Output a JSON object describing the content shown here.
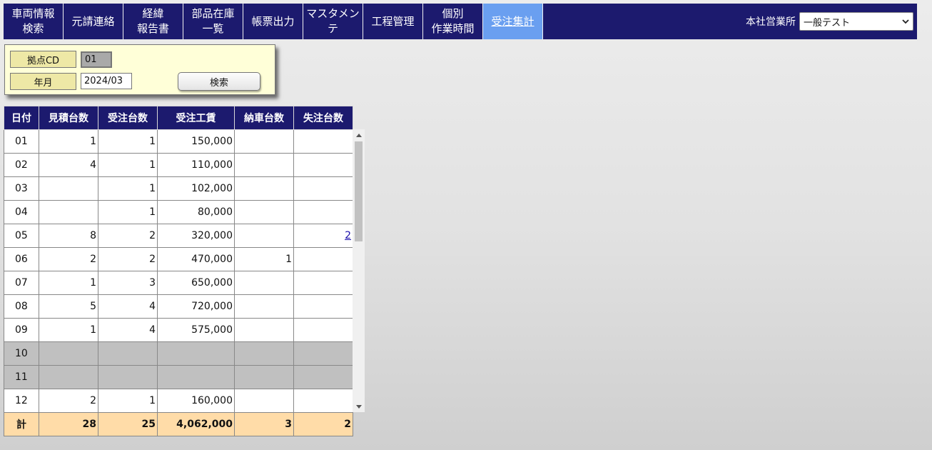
{
  "nav": {
    "items": [
      {
        "line1": "車両情報",
        "line2": "検索"
      },
      {
        "line1": "元請連絡",
        "line2": ""
      },
      {
        "line1": "経緯",
        "line2": "報告書"
      },
      {
        "line1": "部品在庫",
        "line2": "一覧"
      },
      {
        "line1": "帳票出力",
        "line2": ""
      },
      {
        "line1": "マスタメンテ",
        "line2": ""
      },
      {
        "line1": "工程管理",
        "line2": ""
      },
      {
        "line1": "個別",
        "line2": "作業時間"
      },
      {
        "line1": "受注集計",
        "line2": ""
      }
    ],
    "active_index": 8,
    "office_label": "本社営業所",
    "office_selected": "一般テスト"
  },
  "search": {
    "cd_label": "拠点CD",
    "cd_value": "01",
    "ym_label": "年月",
    "ym_value": "2024/03",
    "button_label": "検索"
  },
  "table": {
    "headers": [
      "日付",
      "見積台数",
      "受注台数",
      "受注工賃",
      "納車台数",
      "失注台数"
    ],
    "rows": [
      {
        "day": "01",
        "estimates": "1",
        "orders": "1",
        "labor": "150,000",
        "deliveries": "",
        "lost": "",
        "holiday": false
      },
      {
        "day": "02",
        "estimates": "4",
        "orders": "1",
        "labor": "110,000",
        "deliveries": "",
        "lost": "",
        "holiday": false
      },
      {
        "day": "03",
        "estimates": "",
        "orders": "1",
        "labor": "102,000",
        "deliveries": "",
        "lost": "",
        "holiday": false
      },
      {
        "day": "04",
        "estimates": "",
        "orders": "1",
        "labor": "80,000",
        "deliveries": "",
        "lost": "",
        "holiday": false
      },
      {
        "day": "05",
        "estimates": "8",
        "orders": "2",
        "labor": "320,000",
        "deliveries": "",
        "lost": "2",
        "holiday": false
      },
      {
        "day": "06",
        "estimates": "2",
        "orders": "2",
        "labor": "470,000",
        "deliveries": "1",
        "lost": "",
        "holiday": false
      },
      {
        "day": "07",
        "estimates": "1",
        "orders": "3",
        "labor": "650,000",
        "deliveries": "",
        "lost": "",
        "holiday": false
      },
      {
        "day": "08",
        "estimates": "5",
        "orders": "4",
        "labor": "720,000",
        "deliveries": "",
        "lost": "",
        "holiday": false
      },
      {
        "day": "09",
        "estimates": "1",
        "orders": "4",
        "labor": "575,000",
        "deliveries": "",
        "lost": "",
        "holiday": false
      },
      {
        "day": "10",
        "estimates": "",
        "orders": "",
        "labor": "",
        "deliveries": "",
        "lost": "",
        "holiday": true
      },
      {
        "day": "11",
        "estimates": "",
        "orders": "",
        "labor": "",
        "deliveries": "",
        "lost": "",
        "holiday": true
      },
      {
        "day": "12",
        "estimates": "2",
        "orders": "1",
        "labor": "160,000",
        "deliveries": "",
        "lost": "",
        "holiday": false
      }
    ],
    "total": {
      "day": "計",
      "estimates": "28",
      "orders": "25",
      "labor": "4,062,000",
      "deliveries": "3",
      "lost": "2"
    }
  },
  "colors": {
    "nav_bg": "#1c1a6e",
    "nav_active": "#6a9ff0",
    "panel_bg": "#ffffd8",
    "label_bg": "#eee8a6",
    "holiday_bg": "#c0c0c0",
    "total_bg": "#ffdca8"
  },
  "icons": {
    "select_arrow": "chevron-down-icon",
    "scroll_up": "arrow-up-icon",
    "scroll_down": "arrow-down-icon"
  }
}
